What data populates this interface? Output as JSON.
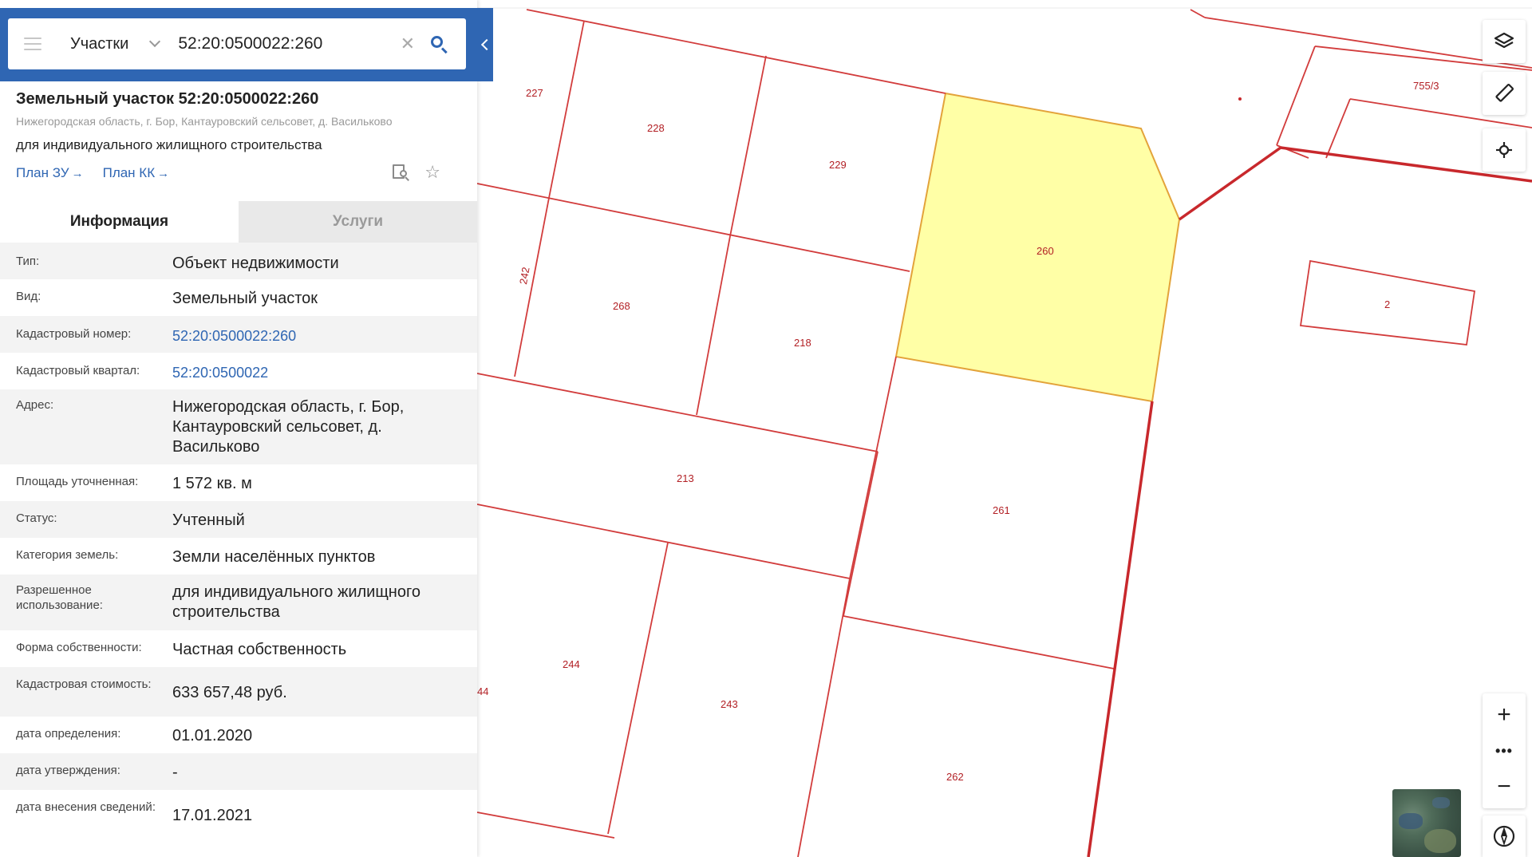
{
  "search": {
    "type_label": "Участки",
    "value": "52:20:0500022:260"
  },
  "header": {
    "title": "Земельный участок 52:20:0500022:260",
    "address": "Нижегородская область, г. Бор, Кантауровский сельсовет, д. Васильково",
    "purpose": "для индивидуального жилищного строительства",
    "link_plan_zu": "План ЗУ",
    "link_plan_kk": "План КК"
  },
  "tabs": {
    "info": "Информация",
    "services": "Услуги"
  },
  "rows": [
    {
      "key": "Тип:",
      "value": "Объект недвижимости"
    },
    {
      "key": "Вид:",
      "value": "Земельный участок"
    },
    {
      "key": "Кадастровый номер:",
      "value": "52:20:0500022:260"
    },
    {
      "key": "Кадастровый квартал:",
      "value": "52:20:0500022"
    },
    {
      "key": "Адрес:",
      "value": "Нижегородская область, г. Бор, Кантауровский сельсовет, д. Васильково"
    },
    {
      "key": "Площадь уточненная:",
      "value": "1 572 кв. м"
    },
    {
      "key": "Статус:",
      "value": "Учтенный"
    },
    {
      "key": "Категория земель:",
      "value": "Земли населённых пунктов"
    },
    {
      "key": "Разрешенное использование:",
      "value": "для индивидуального жилищного строительства"
    },
    {
      "key": "Форма собственности:",
      "value": "Частная собственность"
    },
    {
      "key": "Кадастровая стоимость:",
      "value": "633 657,48 руб."
    },
    {
      "key": "дата определения:",
      "value": "01.01.2020"
    },
    {
      "key": "дата утверждения:",
      "value": "-"
    },
    {
      "key": "дата внесения сведений:",
      "value": "17.01.2021"
    }
  ],
  "map": {
    "parcel_labels": {
      "p227": "227",
      "p228": "228",
      "p229": "229",
      "p260": "260",
      "p242": "242",
      "p268": "268",
      "p218": "218",
      "p213": "213",
      "p261": "261",
      "p244": "244",
      "p243": "243",
      "p262": "262",
      "p2": "2",
      "p755": "755/3",
      "p44": "44"
    },
    "selected_parcel": "260",
    "colors": {
      "boundary": "#d23c3c",
      "boundary_thick": "#c8282c",
      "selected_fill": "#ffffa6",
      "selected_stroke": "#e3a33a",
      "accent": "#2f66b3"
    },
    "controls": {
      "zoom_in": "+",
      "zoom_out": "−",
      "more": "•••"
    },
    "icons": [
      "layers-icon",
      "ruler-icon",
      "locate-icon",
      "compass-icon"
    ]
  }
}
